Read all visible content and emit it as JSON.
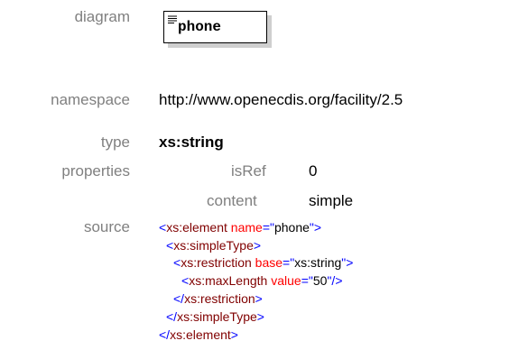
{
  "labels": {
    "diagram": "diagram",
    "namespace": "namespace",
    "type": "type",
    "properties": "properties",
    "source": "source"
  },
  "diagram": {
    "element_name": "phone"
  },
  "namespace": "http://www.openecdis.org/facility/2.5",
  "type": "xs:string",
  "properties": [
    {
      "key": "isRef",
      "value": "0"
    },
    {
      "key": "content",
      "value": "simple"
    }
  ],
  "source": {
    "lines": [
      {
        "open": "<",
        "tag": "xs:element",
        "attr": "name",
        "eq": "=\"",
        "value": "phone",
        "close": "\">"
      },
      {
        "open": "<",
        "tag": "xs:simpleType",
        "close": ">"
      },
      {
        "open": "<",
        "tag": "xs:restriction",
        "attr": "base",
        "eq": "=\"",
        "value": "xs:string",
        "close": "\">"
      },
      {
        "open": "<",
        "tag": "xs:maxLength",
        "attr": "value",
        "eq": "=\"",
        "value": "50",
        "close": "\"/>"
      },
      {
        "open": "</",
        "tag": "xs:restriction",
        "close": ">"
      },
      {
        "open": "</",
        "tag": "xs:simpleType",
        "close": ">"
      },
      {
        "open": "</",
        "tag": "xs:element",
        "close": ">"
      }
    ]
  },
  "colors": {
    "label": "#808080",
    "tag": "#800000",
    "attribute": "#ff0000",
    "punctuation": "#0000ff",
    "shadow": "#cfcfcf"
  }
}
